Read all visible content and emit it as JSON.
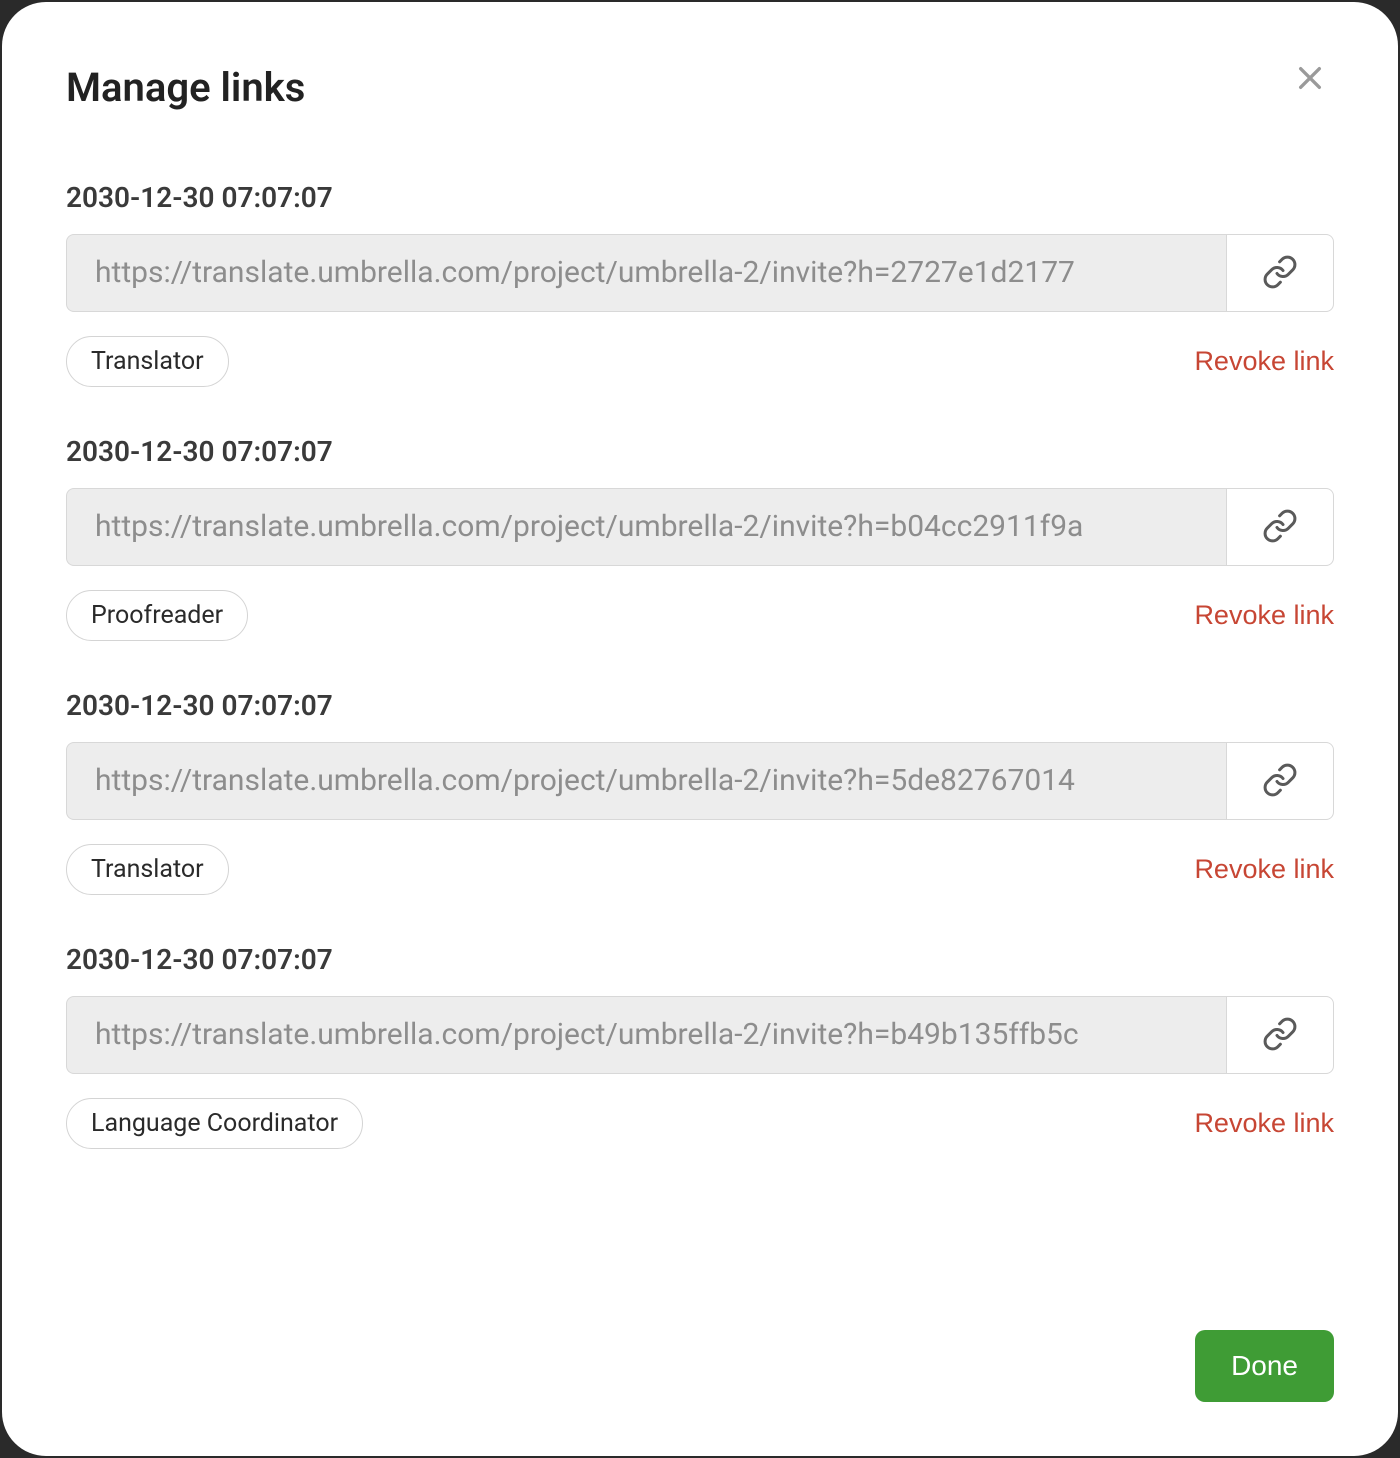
{
  "modal": {
    "title": "Manage links",
    "close_label": "Close",
    "done_label": "Done"
  },
  "links": [
    {
      "timestamp": "2030-12-30 07:07:07",
      "url": "https://translate.umbrella.com/project/umbrella-2/invite?h=2727e1d2177",
      "role": "Translator",
      "revoke_label": "Revoke link"
    },
    {
      "timestamp": "2030-12-30 07:07:07",
      "url": "https://translate.umbrella.com/project/umbrella-2/invite?h=b04cc2911f9a",
      "role": "Proofreader",
      "revoke_label": "Revoke link"
    },
    {
      "timestamp": "2030-12-30 07:07:07",
      "url": "https://translate.umbrella.com/project/umbrella-2/invite?h=5de82767014",
      "role": "Translator",
      "revoke_label": "Revoke link"
    },
    {
      "timestamp": "2030-12-30 07:07:07",
      "url": "https://translate.umbrella.com/project/umbrella-2/invite?h=b49b135ffb5c",
      "role": "Language Coordinator",
      "revoke_label": "Revoke link"
    }
  ]
}
